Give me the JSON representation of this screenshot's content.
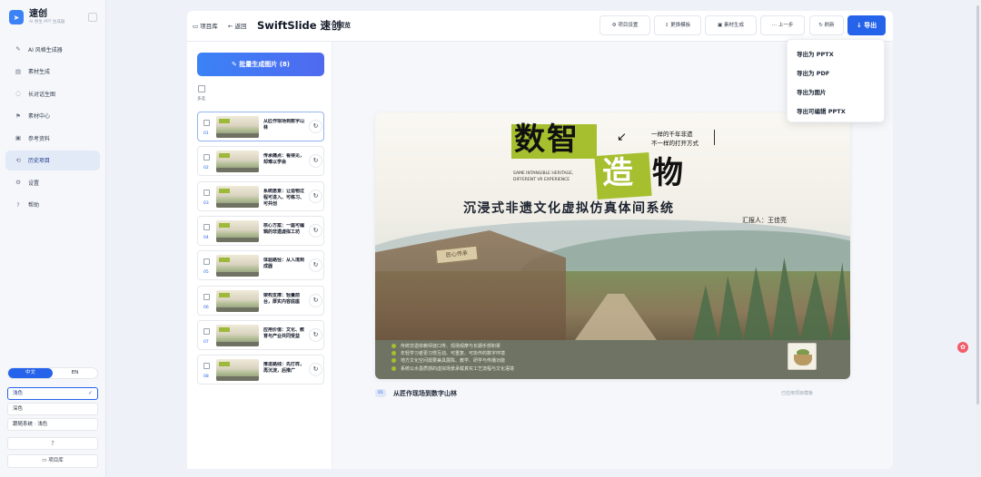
{
  "app": {
    "name": "速创",
    "subtitle": "AI 原生 PPT 生成器"
  },
  "sidebar": {
    "items": [
      {
        "icon": "✎",
        "label": "AI 风格生成器"
      },
      {
        "icon": "▤",
        "label": "素材生成"
      },
      {
        "icon": "◌",
        "label": "长对话生图"
      },
      {
        "icon": "⚑",
        "label": "素材中心"
      },
      {
        "icon": "▣",
        "label": "参考资料"
      },
      {
        "icon": "⟲",
        "label": "历史项目",
        "active": true
      },
      {
        "icon": "⚙",
        "label": "设置"
      },
      {
        "icon": "?",
        "label": "帮助"
      }
    ],
    "lang_zh": "中文",
    "lang_en": "EN",
    "themes": [
      "浅色",
      "深色",
      "跟随系统 · 浅色"
    ],
    "theme_check": "✓",
    "help_icon": "?",
    "project_lib": "项目库"
  },
  "toolbar": {
    "crumb_lib": "项目库",
    "crumb_back": "返回",
    "title": "SwiftSlide 速创",
    "preview": "预览",
    "settings": "项目设置",
    "template": "更换模板",
    "material": "素材生成",
    "prev": "上一步",
    "refresh": "刷新",
    "export": "导出"
  },
  "slide_list": {
    "batch_label": "批量生成图片 (8)",
    "multi_label": "多选",
    "regen_icon": "↻",
    "cards": [
      {
        "num": "01",
        "title": "从匠作现场到数字山林"
      },
      {
        "num": "02",
        "title": "传承痛点：看得见，却难以学会"
      },
      {
        "num": "03",
        "title": "系统愿景：让造物过程可进入、可练习、可共创"
      },
      {
        "num": "04",
        "title": "核心方案：一座可编辑的非遗虚拟工坊"
      },
      {
        "num": "05",
        "title": "体验路径：从入境到成器"
      },
      {
        "num": "06",
        "title": "架构支撑：轻量前台，厚实内容底座"
      },
      {
        "num": "07",
        "title": "应用价值：文化、教育与产业共同受益"
      },
      {
        "num": "08",
        "title": "推进路线：先打样，再沉淀，后推广"
      }
    ]
  },
  "slide": {
    "title_big": "数智",
    "title_zao": "造",
    "title_wu": "物",
    "arrow": "↙",
    "tagline1": "一样的千年非遗",
    "tagline2": "不一样的打开方式",
    "en1": "SAME INTANGIBLE HERITAGE,",
    "en2": "DIFFERENT VR EXPERIENCE",
    "subtitle": "沉浸式非遗文化虚拟仿真体间系统",
    "reporter": "汇报人：王佳亮",
    "sign": "匠心传承",
    "bullets": [
      "传统非遗依赖师徒口传、现场观摩与长期手部积累",
      "年轻学习者更习惯互动、可重复、可协作的数字环境",
      "地方文化空间需要兼具展陈、教学、研学与传播功能",
      "系统以水墨质感的虚拟场景承载真实工艺流程与文化语境"
    ]
  },
  "caption": {
    "num": "01",
    "title": "从匠作现场到数字山林",
    "status": "已应用项目模板"
  },
  "export_menu": [
    "导出为 PPTX",
    "导出为 PDF",
    "导出为图片",
    "导出可编辑 PPTX"
  ]
}
